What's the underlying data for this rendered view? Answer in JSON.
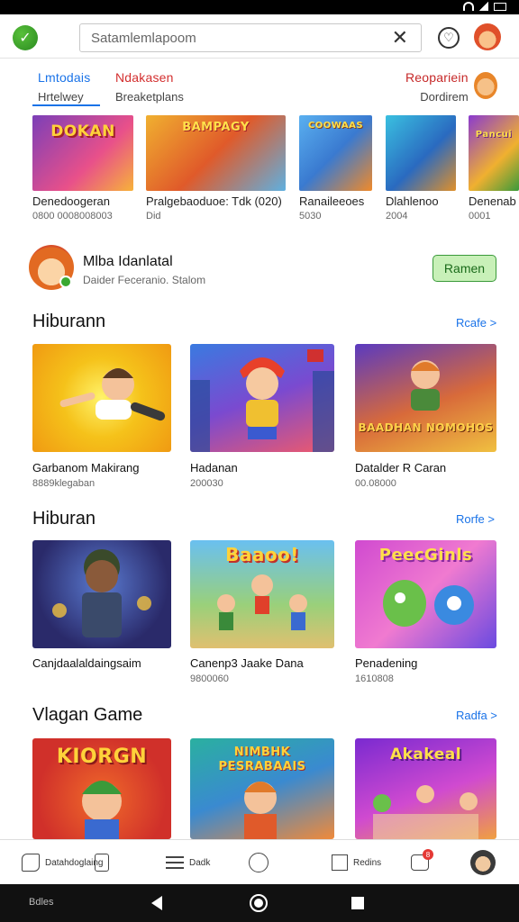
{
  "search": {
    "placeholder": "Satamlemlapoom",
    "clear_icon": "close-icon"
  },
  "tabs": [
    {
      "label": "Lmtodais",
      "sub": "Hrtelwey",
      "color": "#1a73e8"
    },
    {
      "label": "Ndakasen",
      "sub": "Breaketplans",
      "color": "#d32f2f"
    },
    {
      "label": "Reopariein",
      "sub": "Dordirem",
      "color": "#c62828"
    }
  ],
  "featured": [
    {
      "title": "Denedoogeran",
      "sub": "0800 0008008003",
      "art": "DOKAN",
      "bg": "linear-gradient(135deg,#7b3fb8,#e8508a 60%,#f7b23a)"
    },
    {
      "title": "Pralgebaoduoe: Tdk  (020)",
      "sub": "Did",
      "art": "BAMPAGY",
      "bg": "linear-gradient(135deg,#f0b030,#e05a2a 50%,#5fb0e0)"
    },
    {
      "title": "Ranaileeoes",
      "sub": "5030",
      "art": "COOWAAS",
      "bg": "linear-gradient(135deg,#5ab0f0,#3a7ad0 50%,#f08a2a)"
    },
    {
      "title": "Dlahlenoo",
      "sub": "2004",
      "art": "",
      "bg": "linear-gradient(135deg,#3ac0e0,#2a6ac0 55%,#e0902a)"
    },
    {
      "title": "Denenab",
      "sub": "0001",
      "art": "Pancui",
      "bg": "linear-gradient(135deg,#8a3ad0,#f0b030 60%,#3a9a3a)"
    }
  ],
  "profile": {
    "name": "Mlba Idanlatal",
    "sub": "Daider Feceranio. Stalom",
    "button": "Ramen"
  },
  "sections": [
    {
      "title": "Hiburann",
      "more": "Rcafe >",
      "cards": [
        {
          "title": "Garbanom Makirang",
          "sub": "8889klegaban",
          "art": "",
          "bg": "radial-gradient(circle at 50% 50%,#fff36a,#f5c21a 45%,#f09a12)"
        },
        {
          "title": "Hadanan",
          "sub": "200030",
          "art": "",
          "bg": "linear-gradient(160deg,#3a7ae0,#7a4ad0 50%,#f05a6a)"
        },
        {
          "title": "Datalder R Caran",
          "sub": "00.08000",
          "art": "BAADHAN NOMOHOS",
          "bg": "linear-gradient(160deg,#5a3ac0,#d86a3a 55%,#f0c040)"
        }
      ]
    },
    {
      "title": "Hiburan",
      "more": "Rorfe >",
      "cards": [
        {
          "title": "Canjdaalaldaingsaim",
          "sub": "",
          "art": "",
          "bg": "radial-gradient(circle at 50% 40%,#5a7ad0,#2a2a6a 70%)"
        },
        {
          "title": "Canenp3 Jaake Dana",
          "sub": "9800060",
          "art": "Baaoo!",
          "bg": "linear-gradient(180deg,#6ac0f0,#9ad07a 60%,#e0c070)"
        },
        {
          "title": "Penadening",
          "sub": "1610808",
          "art": "PeecGinls",
          "bg": "linear-gradient(135deg,#d04ad0,#f07ad0 50%,#6a4ae0)"
        }
      ]
    },
    {
      "title": "Vlagan Game",
      "more": "Radfa >",
      "cards": [
        {
          "title": "",
          "sub": "",
          "art": "KIORGN",
          "bg": "radial-gradient(circle at 50% 60%,#f06a2a,#d0302a 70%)"
        },
        {
          "title": "",
          "sub": "",
          "art": "NIMBHK PESRABAAIS",
          "bg": "linear-gradient(160deg,#2ab0a0,#3a8ad0 50%,#f08a3a)"
        },
        {
          "title": "",
          "sub": "",
          "art": "Akakeal",
          "bg": "linear-gradient(160deg,#7a2ad0,#d04ad0 55%,#f0a040)"
        }
      ]
    }
  ],
  "bottom_nav": [
    {
      "label": "Datahdoglaing",
      "icon": "puzzle-icon"
    },
    {
      "label": "Dadk",
      "icon": "list-icon"
    },
    {
      "label": "",
      "icon": "clock-icon"
    },
    {
      "label": "Redins",
      "icon": "bookmark-icon"
    },
    {
      "label": "",
      "icon": "chat-icon",
      "badge": "8"
    },
    {
      "label": "",
      "icon": "profile-avatar"
    }
  ],
  "system_nav": {
    "label": "Bdles"
  }
}
